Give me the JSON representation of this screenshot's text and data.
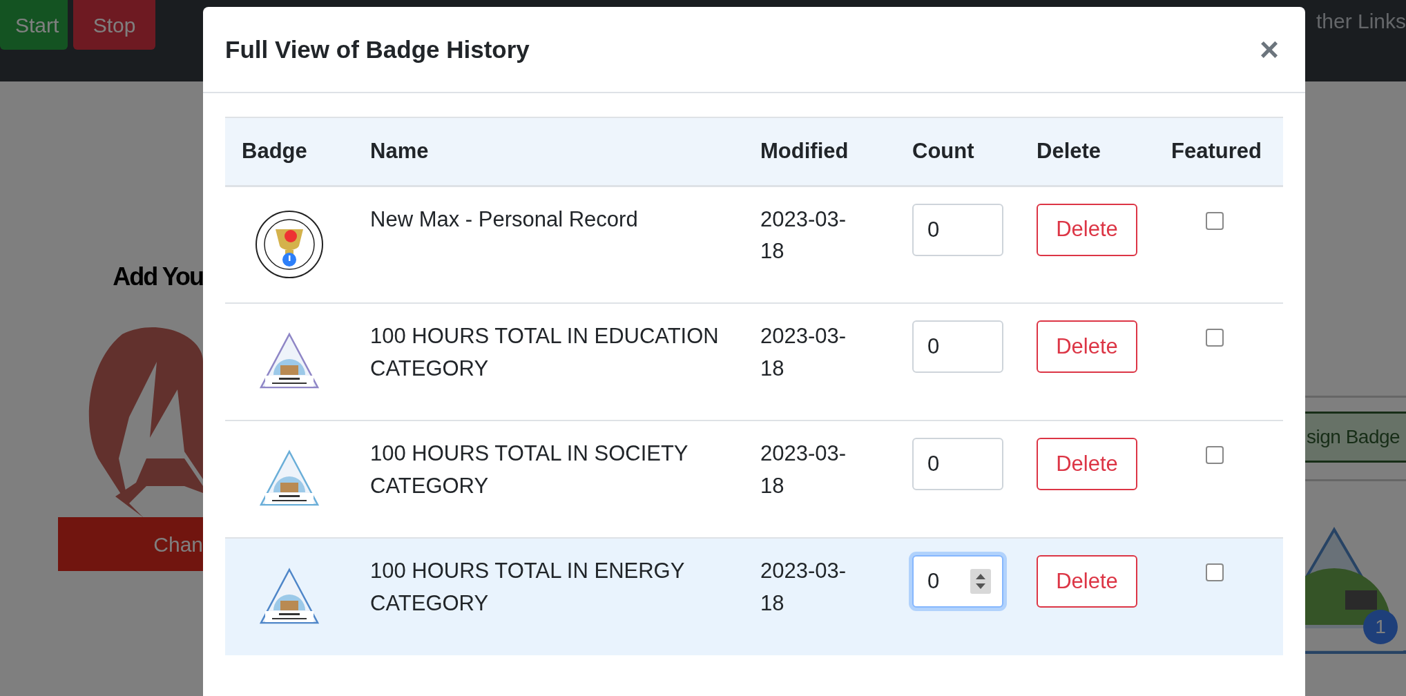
{
  "background": {
    "nav_buttons": [
      {
        "label": "Start",
        "kind": "success"
      },
      {
        "label": "Stop",
        "kind": "danger"
      }
    ],
    "nav_link": "ther Links",
    "heading": "Add You",
    "change_button": "Chan",
    "assign_button": "sign Badge",
    "badge_count": "1"
  },
  "modal": {
    "title": "Full View of Badge History",
    "close": "×",
    "table": {
      "columns": [
        "Badge",
        "Name",
        "Modified",
        "Count",
        "Delete",
        "Featured"
      ],
      "rows": [
        {
          "badge": {
            "kind": "medal",
            "color": "#d4b24c"
          },
          "name": "New Max - Personal Record",
          "modified": "2023-03-18",
          "count": "0",
          "delete": "Delete",
          "featured": false,
          "focused": false,
          "hovered": false
        },
        {
          "badge": {
            "kind": "triangle",
            "color": "#8f86c6"
          },
          "name": "100 HOURS TOTAL IN EDUCATION CATEGORY",
          "modified": "2023-03-18",
          "count": "0",
          "delete": "Delete",
          "featured": false,
          "focused": false,
          "hovered": false
        },
        {
          "badge": {
            "kind": "triangle",
            "color": "#6aaed8"
          },
          "name": "100 HOURS TOTAL IN SOCIETY CATEGORY",
          "modified": "2023-03-18",
          "count": "0",
          "delete": "Delete",
          "featured": false,
          "focused": false,
          "hovered": false
        },
        {
          "badge": {
            "kind": "triangle",
            "color": "#4f86c8"
          },
          "name": "100 HOURS TOTAL IN ENERGY CATEGORY",
          "modified": "2023-03-18",
          "count": "0",
          "delete": "Delete",
          "featured": false,
          "focused": true,
          "hovered": true
        }
      ]
    }
  }
}
